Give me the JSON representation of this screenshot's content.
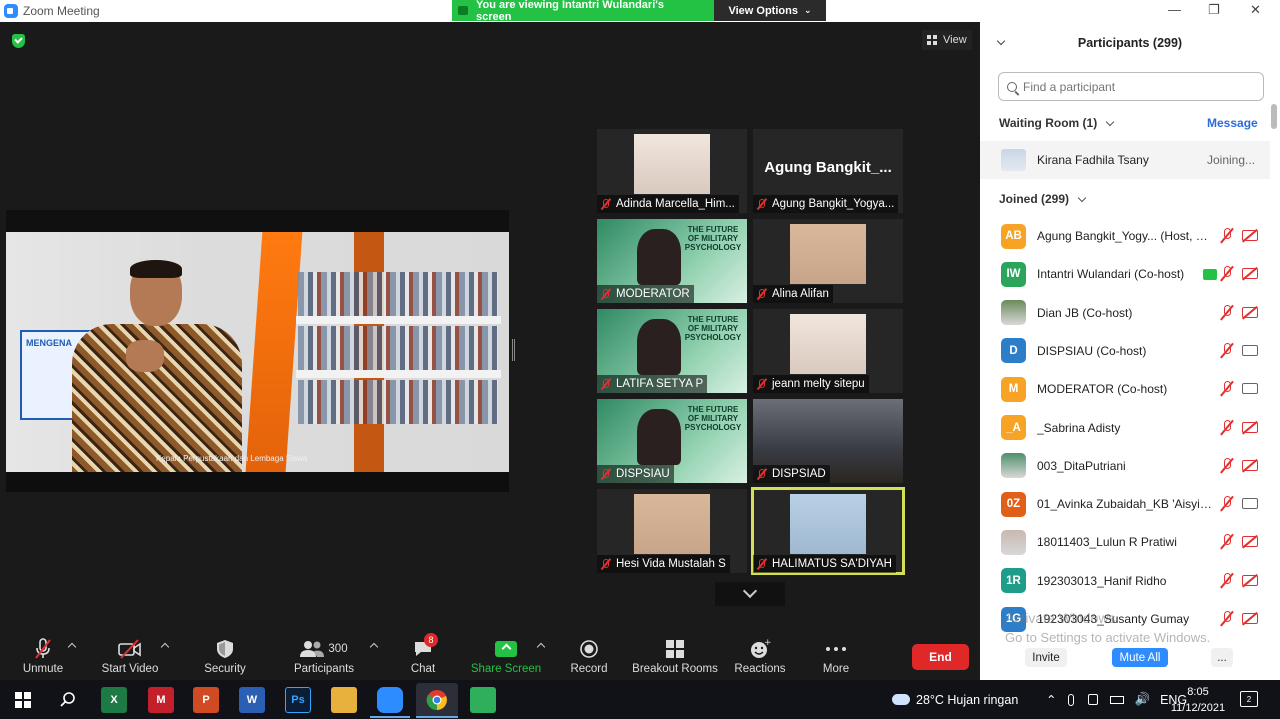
{
  "window": {
    "title": "Zoom Meeting"
  },
  "banner": {
    "viewing_text": "You are viewing Intantri Wulandari's screen",
    "view_options": "View Options"
  },
  "stage": {
    "view_label": "View",
    "shared_poster_text": "MENGENA",
    "shared_caption": "Kepala Perpustakaan dan Lembaga Siswa"
  },
  "tiles": [
    {
      "name": "Adinda Marcella_Him...",
      "type": "photo"
    },
    {
      "name": "Agung Bangkit_Yogya...",
      "type": "name",
      "big_name": "Agung  Bangkit_..."
    },
    {
      "name": "MODERATOR",
      "type": "green",
      "poster": "THE FUTURE OF MILITARY PSYCHOLOGY"
    },
    {
      "name": "Alina Alifan",
      "type": "photo"
    },
    {
      "name": "LATIFA SETYA P",
      "type": "green",
      "poster": "THE FUTURE OF MILITARY PSYCHOLOGY"
    },
    {
      "name": "jeann melty sitepu",
      "type": "photo"
    },
    {
      "name": "DISPSIAU",
      "type": "green",
      "poster": "THE FUTURE OF MILITARY PSYCHOLOGY"
    },
    {
      "name": "DISPSIAD",
      "type": "room"
    },
    {
      "name": "Hesi Vida Mustalah S",
      "type": "photo"
    },
    {
      "name": "HALIMATUS SA'DIYAH",
      "type": "photo",
      "active": true
    }
  ],
  "toolbar": {
    "unmute": "Unmute",
    "start_video": "Start Video",
    "security": "Security",
    "participants": "Participants",
    "participants_count": "300",
    "chat": "Chat",
    "chat_badge": "8",
    "share_screen": "Share Screen",
    "record": "Record",
    "breakout_rooms": "Breakout Rooms",
    "reactions": "Reactions",
    "more": "More",
    "end": "End"
  },
  "panel": {
    "title": "Participants (299)",
    "search_placeholder": "Find a participant",
    "waiting_room": "Waiting Room (1)",
    "message": "Message",
    "waiting": {
      "name": "Kirana Fadhila Tsany",
      "status": "Joining..."
    },
    "joined": "Joined (299)",
    "participants": [
      {
        "initials": "AB",
        "color": "#f7a325",
        "name": "Agung Bangkit_Yogy... (Host, me)",
        "cam": "off"
      },
      {
        "initials": "IW",
        "color": "#2aa55b",
        "name": "Intantri Wulandari (Co-host)",
        "cam": "off",
        "sharing": true
      },
      {
        "initials": "",
        "color": "#6b8a5a",
        "name": "Dian JB (Co-host)",
        "cam": "off",
        "photo": true
      },
      {
        "initials": "D",
        "color": "#2d7ec8",
        "name": "DISPSIAU (Co-host)",
        "cam": "on"
      },
      {
        "initials": "M",
        "color": "#f7a325",
        "name": "MODERATOR (Co-host)",
        "cam": "on"
      },
      {
        "initials": "_A",
        "color": "#f7a325",
        "name": "_Sabrina Adisty",
        "cam": "off"
      },
      {
        "initials": "",
        "color": "#4f8f6a",
        "name": "003_DitaPutriani",
        "cam": "off",
        "photo": true
      },
      {
        "initials": "0Z",
        "color": "#e0601a",
        "name": "01_Avinka Zubaidah_KB 'Aisyiya...",
        "cam": "on"
      },
      {
        "initials": "",
        "color": "#c9b8b0",
        "name": "18011403_Lulun R Pratiwi",
        "cam": "off",
        "photo": true
      },
      {
        "initials": "1R",
        "color": "#1e9d8a",
        "name": "192303013_Hanif Ridho",
        "cam": "off"
      },
      {
        "initials": "1G",
        "color": "#2d7ec8",
        "name": "192303043_Susanty Gumay",
        "cam": "off"
      }
    ],
    "activate_title": "Activate Windows",
    "activate_sub": "Go to Settings to activate Windows.",
    "invite": "Invite",
    "mute_all": "Mute All",
    "more": "..."
  },
  "taskbar": {
    "weather": "28°C  Hujan ringan",
    "lang": "ENG",
    "time": "8:05",
    "date": "11/12/2021",
    "notifications": "2"
  }
}
